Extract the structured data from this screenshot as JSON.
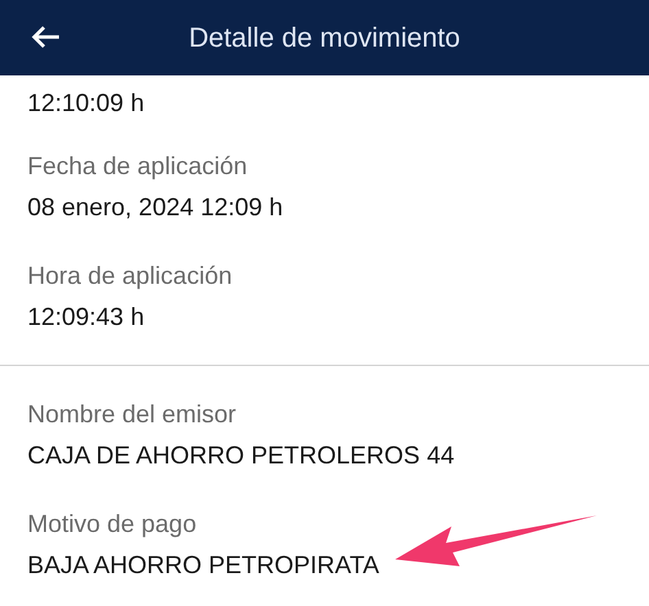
{
  "header": {
    "title": "Detalle de movimiento"
  },
  "sections": [
    {
      "fields": [
        {
          "value": "12:10:09 h"
        },
        {
          "label": "Fecha de aplicación",
          "value": "08 enero, 2024 12:09 h"
        },
        {
          "label": "Hora de aplicación",
          "value": "12:09:43 h"
        }
      ]
    },
    {
      "fields": [
        {
          "label": "Nombre del emisor",
          "value": "CAJA DE AHORRO PETROLEROS 44"
        },
        {
          "label": "Motivo de pago",
          "value": "BAJA AHORRO PETROPIRATA"
        }
      ]
    }
  ]
}
